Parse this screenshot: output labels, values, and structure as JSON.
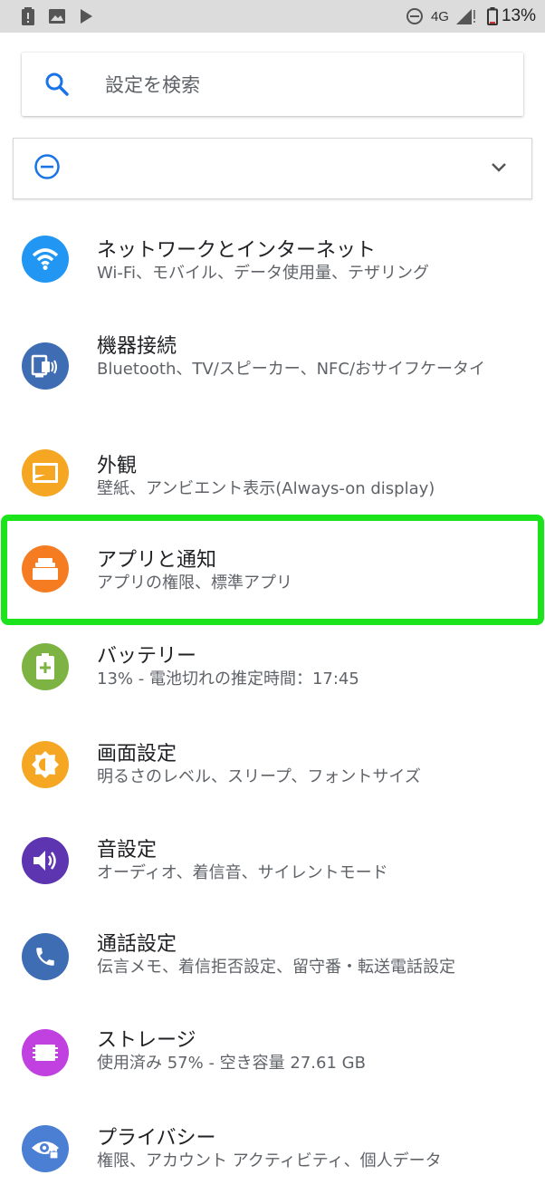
{
  "status_bar": {
    "network": "4G",
    "battery": "13%",
    "icons": [
      "alert-battery-icon",
      "image-icon",
      "play-store-icon",
      "do-not-disturb-icon",
      "signal-icon",
      "battery-icon"
    ]
  },
  "search": {
    "placeholder": "設定を検索",
    "icon": "search-icon"
  },
  "dnd_banner": {
    "icon": "do-not-disturb-icon",
    "expand_icon": "chevron-down-icon"
  },
  "settings": [
    {
      "title": "ネットワークとインターネット",
      "subtitle": "Wi-Fi、モバイル、データ使用量、テザリング",
      "icon": "wifi-icon",
      "color": "#2196f3"
    },
    {
      "title": "機器接続",
      "subtitle": "Bluetooth、TV/スピーカー、NFC/おサイフケータイ",
      "icon": "connected-devices-icon",
      "color": "#3f6db3"
    },
    {
      "title": "外観",
      "subtitle": "壁紙、アンビエント表示(Always-on display)",
      "icon": "wallpaper-icon",
      "color": "#f5a623"
    },
    {
      "title": "アプリと通知",
      "subtitle": "アプリの権限、標準アプリ",
      "icon": "apps-icon",
      "color": "#f57c20"
    },
    {
      "title": "バッテリー",
      "subtitle": "13% - 電池切れの推定時間：17:45",
      "icon": "battery-icon",
      "color": "#7cb342"
    },
    {
      "title": "画面設定",
      "subtitle": "明るさのレベル、スリープ、フォントサイズ",
      "icon": "brightness-icon",
      "color": "#f5a623"
    },
    {
      "title": "音設定",
      "subtitle": "オーディオ、着信音、サイレントモード",
      "icon": "volume-icon",
      "color": "#5e35b1"
    },
    {
      "title": "通話設定",
      "subtitle": "伝言メモ、着信拒否設定、留守番・転送電話設定",
      "icon": "phone-icon",
      "color": "#3f6db3"
    },
    {
      "title": "ストレージ",
      "subtitle": "使用済み 57% - 空き容量 27.61 GB",
      "icon": "storage-icon",
      "color": "#c040e0"
    },
    {
      "title": "プライバシー",
      "subtitle": "権限、アカウント アクティビティ、個人データ",
      "icon": "privacy-icon",
      "color": "#4a7fd4"
    }
  ],
  "highlight_color": "#1ce41c"
}
